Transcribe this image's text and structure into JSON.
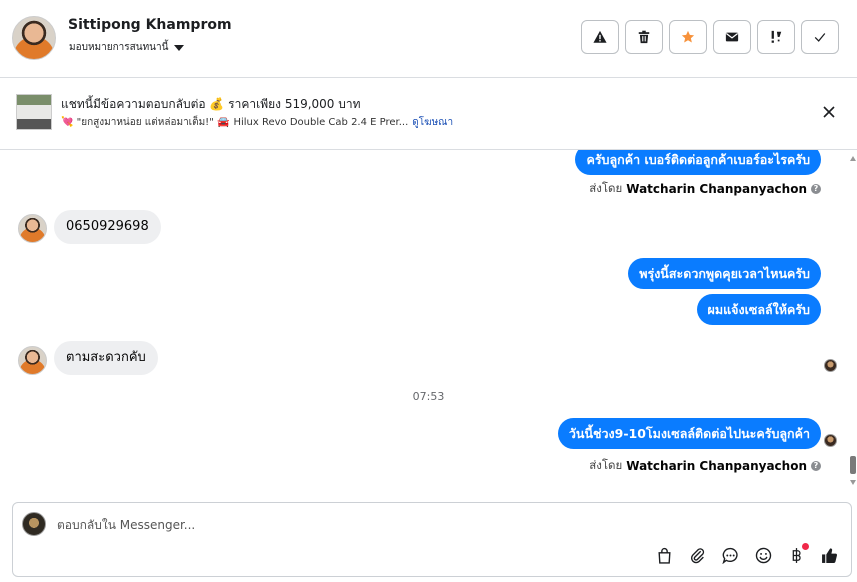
{
  "header": {
    "name": "Sittipong Khamprom",
    "assign_label": "มอบหมายการสนทนานี้",
    "actions": [
      "warning-icon",
      "trash-icon",
      "star-icon",
      "mail-icon",
      "important-icon",
      "check-icon"
    ],
    "star_color": "#f7923b"
  },
  "banner": {
    "title": "แชทนี้มีข้อความตอบกลับต่อ 💰 ราคาเพียง 519,000 บาท",
    "sub_prefix": "💘 \"ยกสูงมาหน่อย แต่หล่อมาเต็ม!\" 🚘",
    "sub_text": "Hilux Revo Double Cab 2.4 E Prer...",
    "link": "ดูโฆษณา"
  },
  "chat": {
    "messages": [
      {
        "dir": "out",
        "text": "ครับลูกค้า เบอร์ติดต่อลูกค้าเบอร์อะไรครับ"
      },
      {
        "dir": "in",
        "text": "0650929698"
      },
      {
        "dir": "out",
        "text": "พรุ่งนี้สะดวกพูดคุยเวลาไหนครับ"
      },
      {
        "dir": "out",
        "text": "ผมแจ้งเซลล์ให้ครับ"
      },
      {
        "dir": "in",
        "text": "ตามสะดวกคับ"
      },
      {
        "dir": "out",
        "text": "วันนี้ช่วง9-10โมงเซลล์ติดต่อไปนะครับลูกค้า"
      }
    ],
    "sent_by_prefix": "ส่งโดย",
    "sent_by_name": "Watcharin Chanpanyachon",
    "timestamp": "07:53",
    "bubble_color": "#0a7cff"
  },
  "composer": {
    "placeholder": "ตอบกลับใน Messenger...",
    "tools": [
      "bag-icon",
      "attach-icon",
      "chat-icon",
      "emoji-icon",
      "baht-icon",
      "thumbs-up-icon"
    ]
  }
}
